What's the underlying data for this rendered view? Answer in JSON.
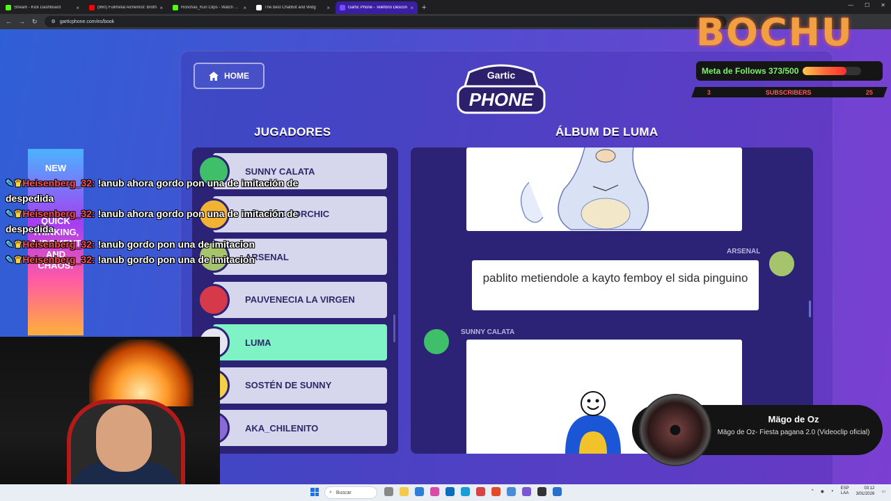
{
  "browser": {
    "tabs": [
      {
        "title": "Stream - Kick Dashboard",
        "color": "#53fc18"
      },
      {
        "title": "(960) Fullmetal Alchemist: Broth",
        "color": "#ff0000"
      },
      {
        "title": "Ronchas_Kun Clips - Watch Live",
        "color": "#53fc18"
      },
      {
        "title": "The best ChatBot and Widg",
        "color": "#ffffff"
      },
      {
        "title": "Gartic Phone - Teléfono Descon",
        "color": "#7c4dff",
        "active": true
      }
    ],
    "url": "garticphone.com/es/book"
  },
  "game": {
    "home_label": "HOME",
    "logo_top": "Gartic",
    "logo_bottom": "PHONE",
    "players_title": "JUGADORES",
    "album_title": "ÁLBUM DE LUMA",
    "players": [
      {
        "name": "SUNNY CALATA",
        "avatar_color": "#3fbf6a"
      },
      {
        "name": "SECO DE TORCHIC",
        "avatar_color": "#f2b233"
      },
      {
        "name": "ARSENAL",
        "avatar_color": "#a6c46b"
      },
      {
        "name": "PAUVENECIA LA VIRGEN",
        "avatar_color": "#d63a4a"
      },
      {
        "name": "LUMA",
        "avatar_color": "#e6e6f2",
        "active": true
      },
      {
        "name": "SOSTÉN DE SUNNY",
        "avatar_color": "#f2d04a"
      },
      {
        "name": "AKA_CHILENITO",
        "avatar_color": "#8a6bd6"
      }
    ],
    "album": {
      "guess_author": "ARSENAL",
      "guess_text": "pablito metiendole a kayto femboy el sida pinguino",
      "drawing_author": "SUNNY CALATA"
    }
  },
  "overlay": {
    "brand": "BOCHU",
    "follows_label": "Meta de Follows 373/500",
    "follows_progress": 0.746,
    "subs_left": "3",
    "subs_label": "SUBSCRIBERS",
    "subs_right": "25",
    "promo_top": "NEW",
    "promo_mid": "QUICK THINKING, JUDGMENT AND CHAOS!",
    "chat": [
      {
        "user": "Heisenberg_32:",
        "msg": "!anub ahora gordo pon una de imitación de despedida"
      },
      {
        "user": "Heisenberg_32:",
        "msg": "!anub ahora gordo pon una de imitación de despedida"
      },
      {
        "user": "Heisenberg_32:",
        "msg": "!anub gordo pon una de imitacion"
      },
      {
        "user": "Heisenberg_32:",
        "msg": "!anub gordo pon una de imitacion"
      }
    ],
    "now_playing": {
      "artist": "Mägo de Oz",
      "song": "Mägo de Oz- Fiesta pagana 2.0 (Videoclip oficial)"
    }
  },
  "taskbar": {
    "search_placeholder": "Buscar",
    "lang": "ESP",
    "lang2": "LAA",
    "time": "03:12",
    "date": "3/01/2026"
  }
}
